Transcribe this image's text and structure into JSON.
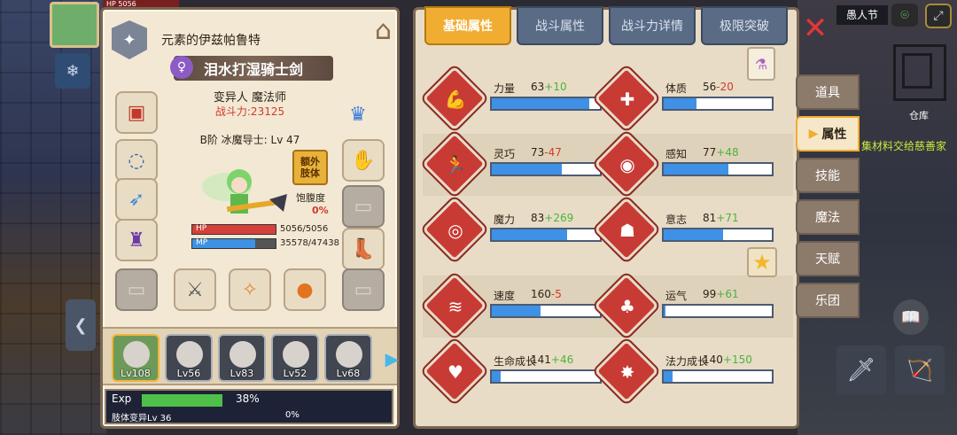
{
  "hud": {
    "hp_mini": "HP 5056",
    "event_label": "愚人节",
    "warehouse": "仓库",
    "materials_notice": "集材料交给慈善家"
  },
  "character": {
    "title": "元素的伊兹帕鲁特",
    "weapon_name": "泪水打湿骑士剑",
    "gender_icon": "female-icon",
    "race_class": "变异人 魔法师",
    "power": "战斗力:23125",
    "rank": "B阶 冰魔导士: Lv 47",
    "extra_limb": "额外\n肢体",
    "satiety_label": "饱腹度",
    "satiety_value": "0%",
    "hp_label": "HP",
    "hp_value": "5056/5056",
    "hp_fraction": 1.0,
    "mp_label": "MP",
    "mp_value": "35578/47438",
    "mp_fraction": 0.75,
    "exp_label": "Exp",
    "exp_pct": "38%",
    "exp_fraction": 0.38,
    "limb_label": "肢体变异Lv 36",
    "limb_pct": "0%"
  },
  "party": [
    {
      "lv": "Lv108",
      "active": true
    },
    {
      "lv": "Lv56",
      "active": false
    },
    {
      "lv": "Lv83",
      "active": false
    },
    {
      "lv": "Lv52",
      "active": false
    },
    {
      "lv": "Lv68",
      "active": false
    }
  ],
  "tabs": [
    "基础属性",
    "战斗属性",
    "战斗力详情",
    "极限突破"
  ],
  "attributes": [
    {
      "name": "力量",
      "base": "63",
      "mod": "+10",
      "sign": "pos",
      "icon": "muscle-arm-icon",
      "fill": 0.9
    },
    {
      "name": "体质",
      "base": "56",
      "mod": "-20",
      "sign": "neg",
      "icon": "muscle-body-icon",
      "fill": 0.3
    },
    {
      "name": "灵巧",
      "base": "73",
      "mod": "-47",
      "sign": "neg",
      "icon": "running-man-icon",
      "fill": 0.65
    },
    {
      "name": "感知",
      "base": "77",
      "mod": "+48",
      "sign": "pos",
      "icon": "eye-icon",
      "fill": 0.6
    },
    {
      "name": "魔力",
      "base": "83",
      "mod": "+269",
      "sign": "pos",
      "icon": "swirl-icon",
      "fill": 0.7
    },
    {
      "name": "意志",
      "base": "81",
      "mod": "+71",
      "sign": "pos",
      "icon": "head-silhouette-icon",
      "fill": 0.55
    },
    {
      "name": "速度",
      "base": "160",
      "mod": "-5",
      "sign": "neg",
      "icon": "speed-lines-icon",
      "fill": 0.45
    },
    {
      "name": "运气",
      "base": "99",
      "mod": "+61",
      "sign": "pos",
      "icon": "clover-icon",
      "fill": 0.02
    },
    {
      "name": "生命成长",
      "base": "141",
      "mod": "+46",
      "sign": "pos",
      "icon": "heart-growth-icon",
      "fill": 0.08
    },
    {
      "name": "法力成长",
      "base": "140",
      "mod": "+150",
      "sign": "pos",
      "icon": "mana-growth-icon",
      "fill": 0.08
    }
  ],
  "side_menu": [
    "道具",
    "属性",
    "技能",
    "魔法",
    "天赋",
    "乐团"
  ],
  "side_menu_active": 1
}
